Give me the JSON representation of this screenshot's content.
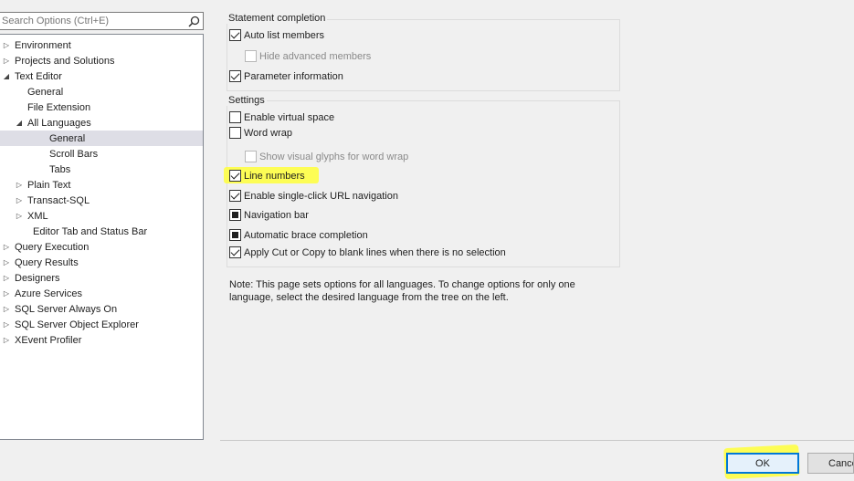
{
  "search": {
    "placeholder": "Search Options (Ctrl+E)"
  },
  "tree": {
    "environment": "Environment",
    "projects": "Projects and Solutions",
    "text_editor": "Text Editor",
    "general": "General",
    "file_extension": "File Extension",
    "all_languages": "All Languages",
    "al_general": "General",
    "scroll_bars": "Scroll Bars",
    "tabs": "Tabs",
    "plain_text": "Plain Text",
    "transact_sql": "Transact-SQL",
    "xml": "XML",
    "editor_tab": "Editor Tab and Status Bar",
    "query_execution": "Query Execution",
    "query_results": "Query Results",
    "designers": "Designers",
    "azure": "Azure Services",
    "always_on": "SQL Server Always On",
    "object_explorer": "SQL Server Object Explorer",
    "xevent": "XEvent Profiler"
  },
  "statement": {
    "title": "Statement completion",
    "auto_list": "Auto list members",
    "hide_advanced": "Hide advanced members",
    "param_info": "Parameter information"
  },
  "settings": {
    "title": "Settings",
    "virtual_space": "Enable virtual space",
    "word_wrap": "Word wrap",
    "visual_glyphs": "Show visual glyphs for word wrap",
    "line_numbers": "Line numbers",
    "single_click": "Enable single-click URL navigation",
    "nav_bar": "Navigation bar",
    "brace": "Automatic brace completion",
    "cut_copy": "Apply Cut or Copy to blank lines when there is no selection"
  },
  "note": "Note: This page sets options for all languages. To change options for only one language, select the desired language from the tree on the left.",
  "buttons": {
    "ok": "OK",
    "cancel": "Cancel"
  }
}
